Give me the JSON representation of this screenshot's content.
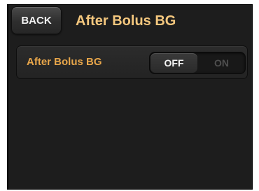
{
  "header": {
    "back_label": "BACK",
    "title": "After Bolus BG"
  },
  "setting": {
    "label": "After Bolus BG",
    "toggle": {
      "off_label": "OFF",
      "on_label": "ON",
      "selected": "OFF"
    }
  },
  "colors": {
    "background": "#1d1d1d",
    "title": "#f4c77e",
    "setting_label": "#e8a64a"
  }
}
